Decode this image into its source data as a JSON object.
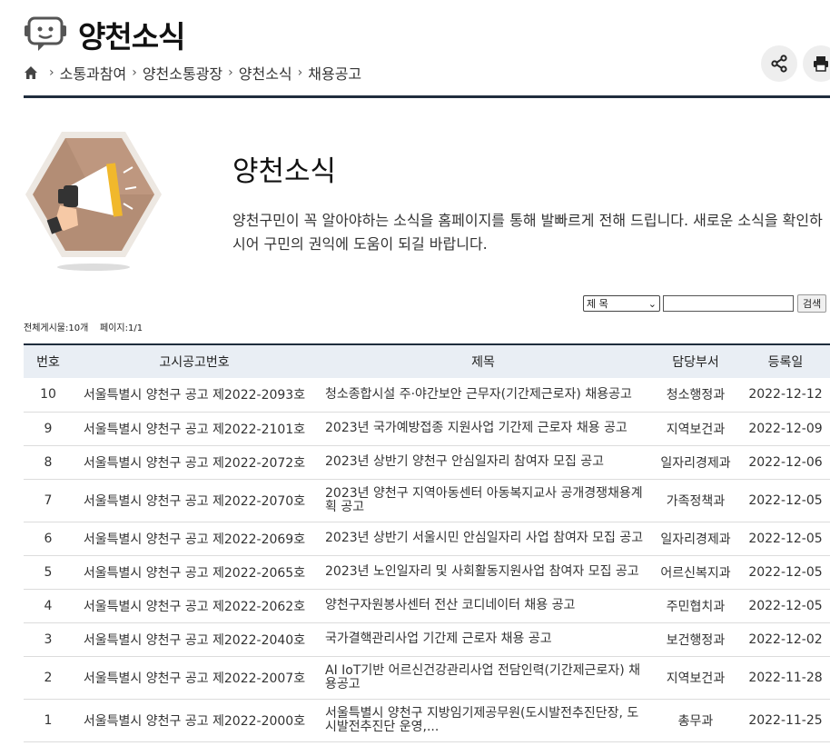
{
  "header": {
    "title": "양천소식",
    "breadcrumb": [
      "소통과참여",
      "양천소통광장",
      "양천소식",
      "채용공고"
    ]
  },
  "tools": {
    "share_icon": "share-icon",
    "print_icon": "print-icon"
  },
  "intro": {
    "title": "양천소식",
    "description": "양천구민이 꼭 알아야하는 소식을 홈페이지를 통해 발빠르게 전해 드립니다. 새로운 소식을 확인하시어 구민의 권익에 도움이 되길 바랍니다."
  },
  "search": {
    "selected": "제 목",
    "value": "",
    "button": "검색"
  },
  "board_info": {
    "total": "전체게시물:10개",
    "page": "페이지:1/1"
  },
  "table": {
    "headers": [
      "번호",
      "고시공고번호",
      "제목",
      "담당부서",
      "등록일"
    ],
    "rows": [
      [
        "10",
        "서울특별시 양천구 공고 제2022-2093호",
        "청소종합시설 주·야간보안 근무자(기간제근로자) 채용공고",
        "청소행정과",
        "2022-12-12"
      ],
      [
        "9",
        "서울특별시 양천구 공고 제2022-2101호",
        "2023년 국가예방접종 지원사업 기간제 근로자 채용 공고",
        "지역보건과",
        "2022-12-09"
      ],
      [
        "8",
        "서울특별시 양천구 공고 제2022-2072호",
        "2023년 상반기 양천구 안심일자리 참여자 모집 공고",
        "일자리경제과",
        "2022-12-06"
      ],
      [
        "7",
        "서울특별시 양천구 공고 제2022-2070호",
        "2023년 양천구 지역아동센터 아동복지교사 공개경쟁채용계획 공고",
        "가족정책과",
        "2022-12-05"
      ],
      [
        "6",
        "서울특별시 양천구 공고 제2022-2069호",
        "2023년 상반기 서울시민 안심일자리 사업 참여자 모집 공고",
        "일자리경제과",
        "2022-12-05"
      ],
      [
        "5",
        "서울특별시 양천구 공고 제2022-2065호",
        "2023년 노인일자리 및 사회활동지원사업 참여자 모집 공고",
        "어르신복지과",
        "2022-12-05"
      ],
      [
        "4",
        "서울특별시 양천구 공고 제2022-2062호",
        "양천구자원봉사센터 전산 코디네이터 채용 공고",
        "주민협치과",
        "2022-12-05"
      ],
      [
        "3",
        "서울특별시 양천구 공고 제2022-2040호",
        "국가결핵관리사업 기간제 근로자 채용 공고",
        "보건행정과",
        "2022-12-02"
      ],
      [
        "2",
        "서울특별시 양천구 공고 제2022-2007호",
        "AI IoT기반 어르신건강관리사업 전담인력(기간제근로자) 채용공고",
        "지역보건과",
        "2022-11-28"
      ],
      [
        "1",
        "서울특별시 양천구 공고 제2022-2000호",
        "서울특별시 양천구 지방임기제공무원(도시발전추진단장, 도시발전추진단 운영,...",
        "총무과",
        "2022-11-25"
      ]
    ]
  }
}
